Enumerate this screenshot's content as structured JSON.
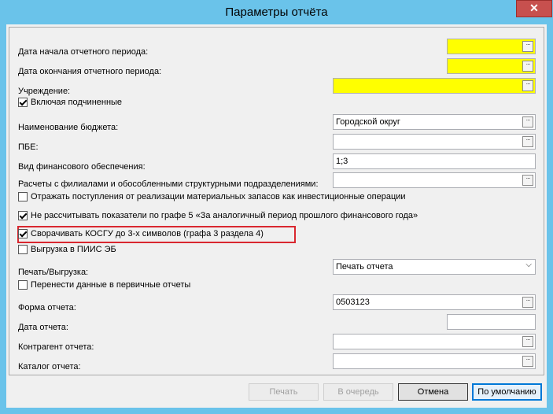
{
  "window": {
    "title": "Параметры отчёта",
    "close_label": "✕"
  },
  "fields": {
    "period_start": {
      "label": "Дата начала отчетного периода:",
      "value": ""
    },
    "period_end": {
      "label": "Дата окончания отчетного периода:",
      "value": ""
    },
    "institution": {
      "label": "Учреждение:",
      "value": ""
    },
    "include_subordinate": {
      "label": "Включая подчиненные",
      "checked": true
    },
    "budget_name": {
      "label": "Наименование бюджета:",
      "value": "Городской округ"
    },
    "pbe": {
      "label": "ПБЕ:",
      "value": ""
    },
    "funding_type": {
      "label": "Вид финансового обеспечения:",
      "value": "1;3"
    },
    "branches": {
      "label": "Расчеты с филиалами и обособленными структурными подразделениями:",
      "value": ""
    },
    "reflect_receipts": {
      "label": "Отражать поступления от реализации материальных запасов как инвестиционные операции",
      "checked": false
    },
    "no_calc_col5": {
      "label": "Не рассчитывать показатели по графе 5 «За аналогичный период прошлого финансового года»",
      "checked": true
    },
    "collapse_kosgu": {
      "label": "Сворачивать КОСГУ до 3-х символов (графа 3 раздела 4)",
      "checked": true
    },
    "export_piis": {
      "label": "Выгрузка в ПИИС ЭБ",
      "checked": false
    },
    "print_export": {
      "label": "Печать/Выгрузка:",
      "value": "Печать отчета"
    },
    "transfer_primary": {
      "label": "Перенести данные в первичные отчеты",
      "checked": false
    },
    "report_form": {
      "label": "Форма отчета:",
      "value": "0503123"
    },
    "report_date": {
      "label": "Дата отчета:",
      "value": ""
    },
    "counterparty": {
      "label": "Контрагент отчета:",
      "value": ""
    },
    "catalog": {
      "label": "Каталог отчета:",
      "value": ""
    }
  },
  "ellipsis_glyph": "···",
  "buttons": {
    "print": "Печать",
    "queue": "В очередь",
    "cancel": "Отмена",
    "default": "По умолчанию"
  },
  "colors": {
    "required_field": "#ffff00",
    "highlight": "#d9272f",
    "title_bar": "#6ac3ea"
  }
}
